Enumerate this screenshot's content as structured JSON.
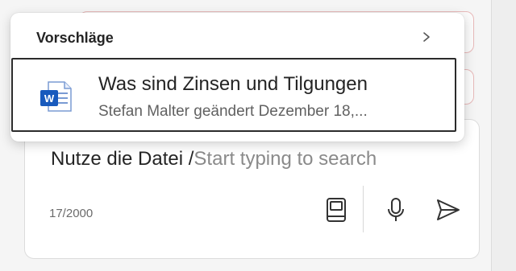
{
  "suggestions_popup": {
    "title": "Vorschläge",
    "items": [
      {
        "icon": "word-document-icon",
        "title": "Was sind Zinsen und Tilgungen",
        "subtitle": "Stefan Malter geändert Dezember 18,..."
      }
    ]
  },
  "composer": {
    "typed_text": "Nutze die Datei /",
    "placeholder": "Start typing to search",
    "char_count": "17/2000"
  },
  "colors": {
    "word_blue": "#185abd",
    "accent_border": "#e8b9b9"
  }
}
